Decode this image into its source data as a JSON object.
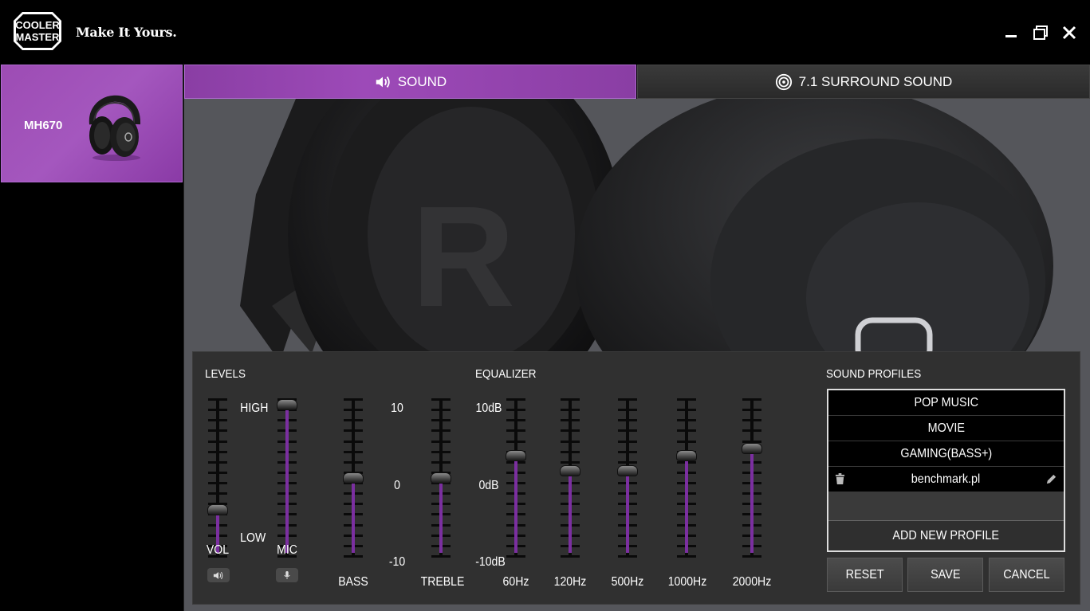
{
  "app": {
    "brand_line1": "COOLER",
    "brand_line2": "MASTER",
    "slogan": "Make It Yours."
  },
  "window_controls": [
    "minimize",
    "restore",
    "close"
  ],
  "sidebar": {
    "devices": [
      {
        "name": "MH670",
        "selected": true
      }
    ]
  },
  "tabs": [
    {
      "label": "SOUND",
      "icon": "speaker-icon",
      "active": true
    },
    {
      "label": "7.1 SURROUND SOUND",
      "icon": "surround-speaker-icon",
      "active": false
    }
  ],
  "levels": {
    "title": "LEVELS",
    "high_label": "HIGH",
    "low_label": "LOW",
    "vol_label": "VOL",
    "mic_label": "MIC",
    "vol_level": 0.28,
    "mic_level": 1.0
  },
  "tone": {
    "max_label": "10",
    "mid_label": "0",
    "min_label": "-10",
    "bass_label": "BASS",
    "treble_label": "TREBLE",
    "bass_value": 0,
    "treble_value": 0
  },
  "equalizer": {
    "title": "EQUALIZER",
    "max_label": "10dB",
    "mid_label": "0dB",
    "min_label": "-10dB",
    "bands": [
      {
        "label": "60Hz",
        "value": 3
      },
      {
        "label": "120Hz",
        "value": 1
      },
      {
        "label": "500Hz",
        "value": 1
      },
      {
        "label": "1000Hz",
        "value": 3
      },
      {
        "label": "2000Hz",
        "value": 4
      }
    ]
  },
  "profiles": {
    "title": "SOUND PROFILES",
    "items": [
      {
        "label": "POP MUSIC"
      },
      {
        "label": "MOVIE"
      },
      {
        "label": "GAMING(BASS+)"
      },
      {
        "label": "benchmark.pl",
        "custom": true
      }
    ],
    "add_label": "ADD NEW PROFILE"
  },
  "buttons": {
    "reset": "RESET",
    "save": "SAVE",
    "cancel": "CANCEL"
  },
  "colors": {
    "accent": "#9d4ab8",
    "fill": "#7b2fa0",
    "panel": "#303030"
  }
}
